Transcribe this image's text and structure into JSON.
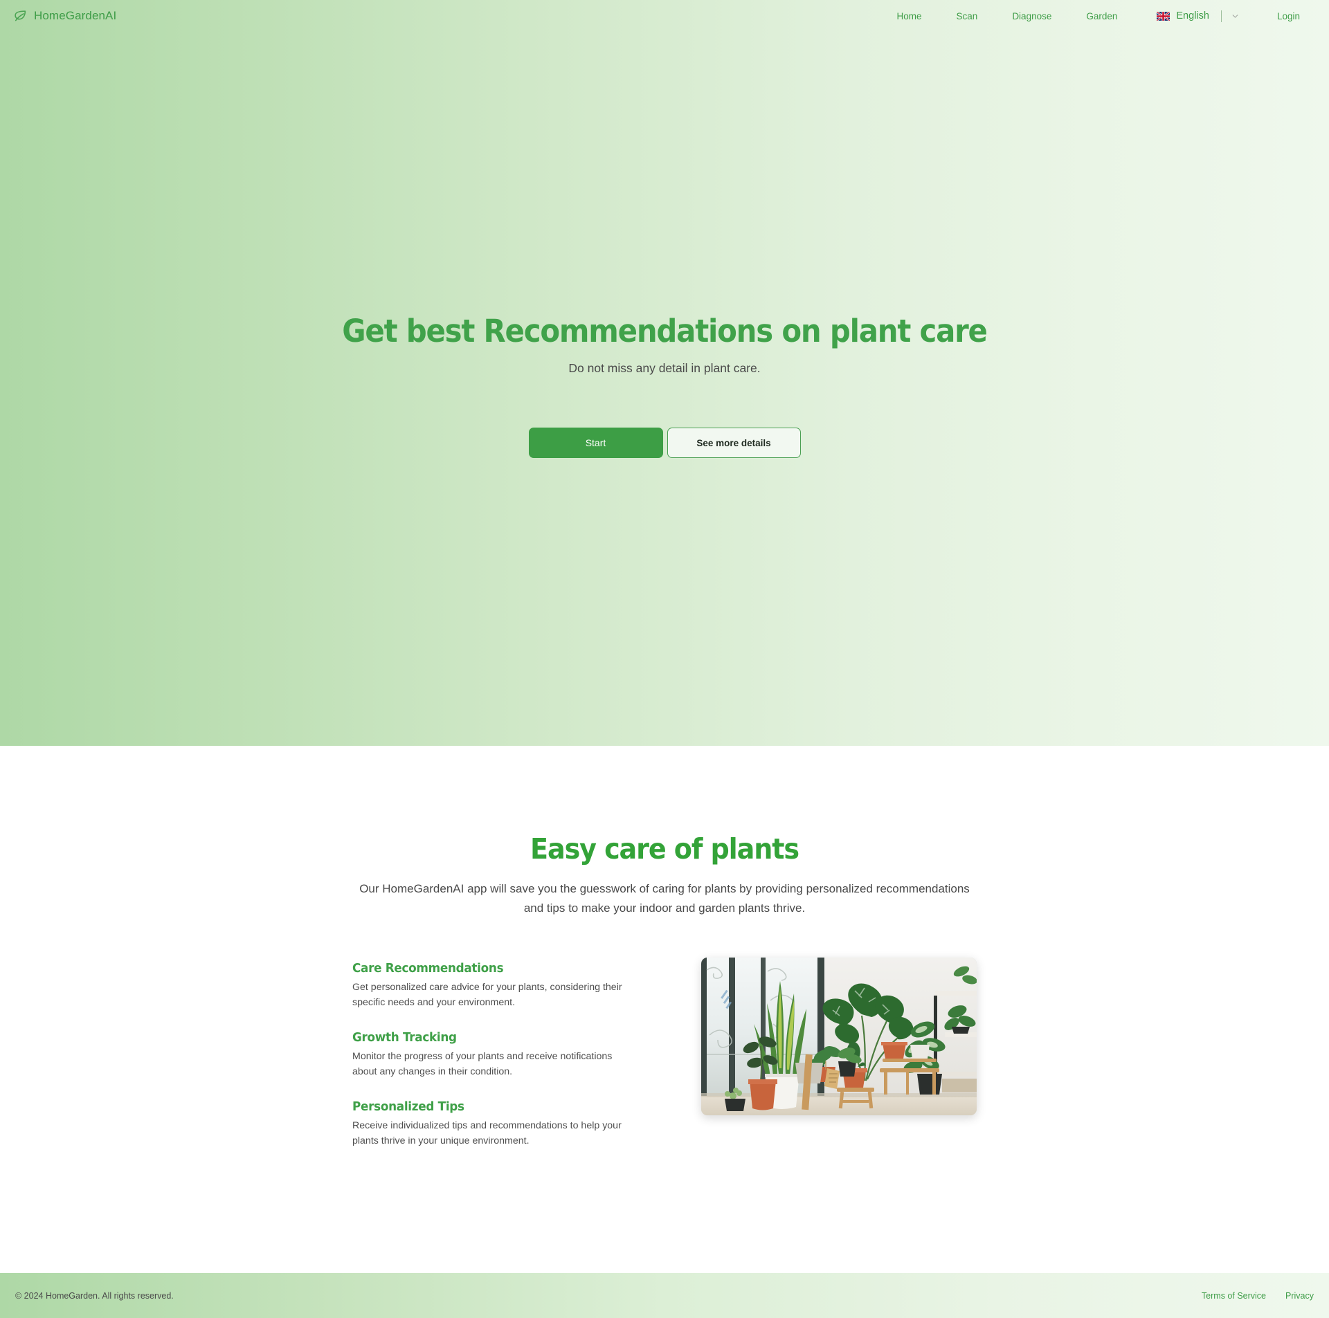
{
  "brand": {
    "name": "HomeGardenAI",
    "icon": "leaf-icon",
    "color": "#3f9d48"
  },
  "nav": {
    "links": [
      {
        "label": "Home"
      },
      {
        "label": "Scan"
      },
      {
        "label": "Diagnose"
      },
      {
        "label": "Garden"
      }
    ],
    "language": {
      "label": "English",
      "flag": "uk-flag-icon",
      "chevron": "chevron-down-icon"
    },
    "login_label": "Login"
  },
  "hero": {
    "title": "Get best Recommendations on plant care",
    "subtitle": "Do not miss any detail in plant care.",
    "primary_button": "Start",
    "secondary_button": "See more details",
    "title_color": "#40a24a",
    "gradient_from": "#aed8a6",
    "gradient_to": "#eff8ed"
  },
  "features_section": {
    "title": "Easy care of plants",
    "description": "Our HomeGardenAI app will save you the guesswork of caring for plants by providing personalized recommendations and tips to make your indoor and garden plants thrive.",
    "items": [
      {
        "title": "Care Recommendations",
        "text": "Get personalized care advice for your plants, considering their specific needs and your environment."
      },
      {
        "title": "Growth Tracking",
        "text": "Monitor the progress of your plants and receive notifications about any changes in their condition."
      },
      {
        "title": "Personalized Tips",
        "text": "Receive individualized tips and recommendations to help your plants thrive in your unique environment."
      }
    ],
    "image_alt": "indoor-plants-photo",
    "accent_color": "#3fa048"
  },
  "footer": {
    "copyright": "© 2024 HomeGarden. All rights reserved.",
    "links": [
      {
        "label": "Terms of Service"
      },
      {
        "label": "Privacy"
      }
    ]
  }
}
